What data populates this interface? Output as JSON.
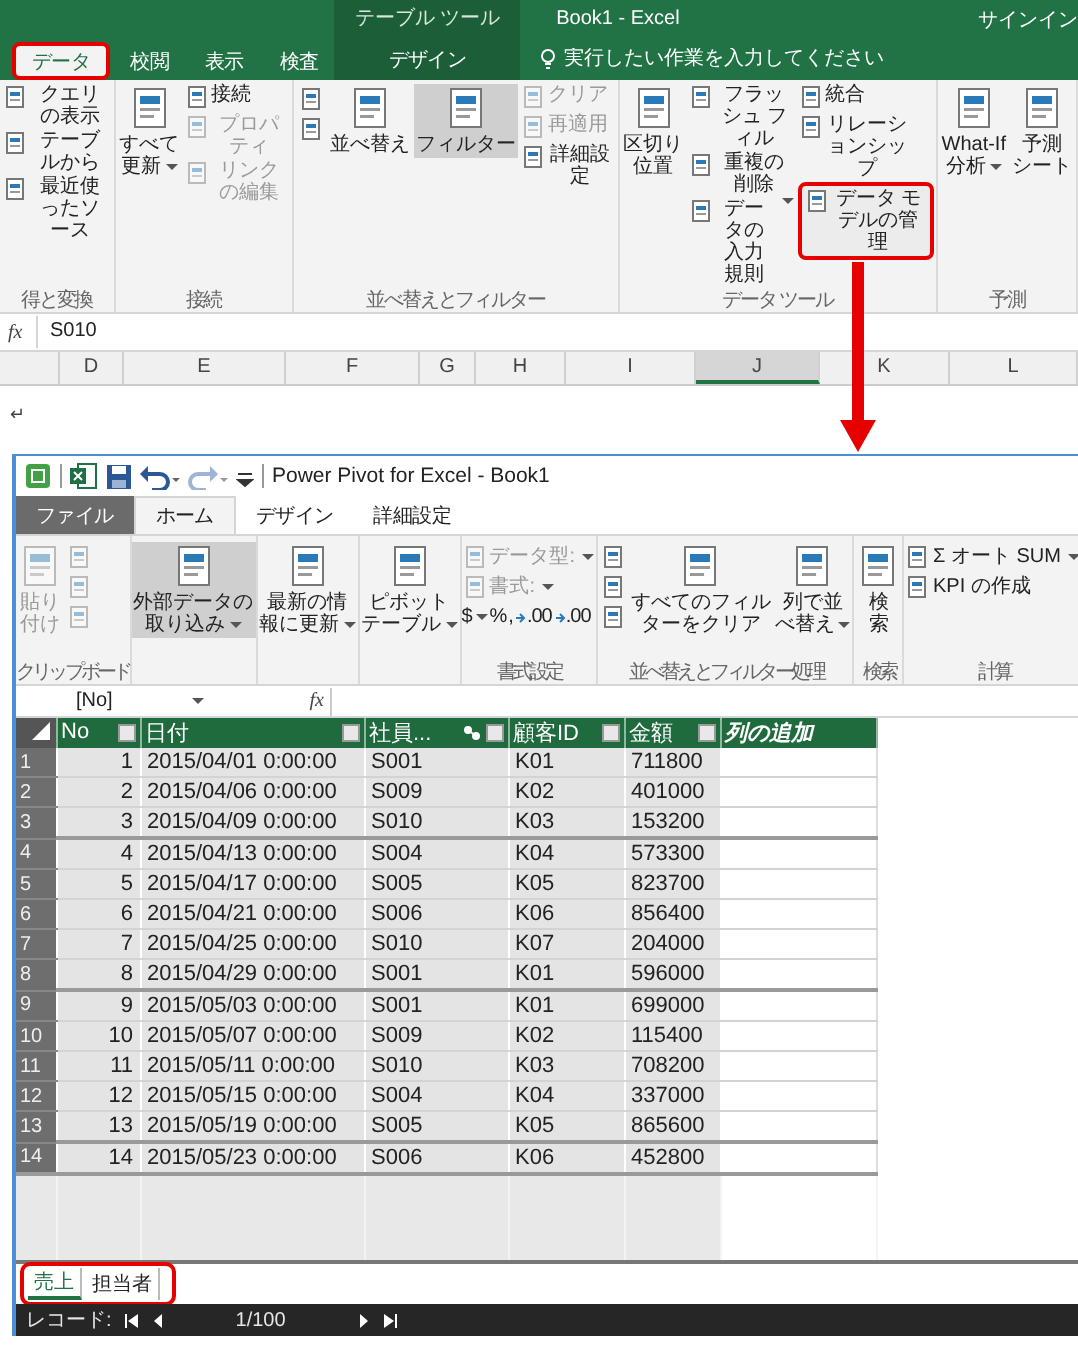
{
  "excel": {
    "context_label": "テーブル ツール",
    "title": "Book1 - Excel",
    "account": "サインイン",
    "tabs": [
      {
        "label": "データ",
        "kind": "normal",
        "selected": true,
        "highlighted": true
      },
      {
        "label": "校閲",
        "kind": "normal",
        "selected": false,
        "highlighted": false
      },
      {
        "label": "表示",
        "kind": "normal",
        "selected": false,
        "highlighted": false
      },
      {
        "label": "検査",
        "kind": "normal",
        "selected": false,
        "highlighted": false
      },
      {
        "label": "デザイン",
        "kind": "context",
        "selected": false,
        "highlighted": false
      }
    ],
    "tell_me": {
      "placeholder": "実行したい作業を入力してください"
    },
    "ribbon_groups": [
      {
        "label": "得と変換",
        "columns": [
          [
            {
              "kind": "small",
              "label": "クエリの表示",
              "disabled": false,
              "selected": false,
              "highlighted": false
            },
            {
              "kind": "small",
              "label": "テーブルから",
              "disabled": false,
              "selected": false,
              "highlighted": false
            },
            {
              "kind": "small",
              "label": "最近使ったソース",
              "disabled": false,
              "selected": false,
              "highlighted": false
            }
          ]
        ]
      },
      {
        "label": "接続",
        "columns": [
          [
            {
              "kind": "large",
              "lines": [
                "すべて",
                "更新"
              ],
              "dropdown": true,
              "disabled": false,
              "selected": false,
              "highlighted": false
            }
          ],
          [
            {
              "kind": "small",
              "label": "接続",
              "disabled": false,
              "selected": false,
              "highlighted": false
            },
            {
              "kind": "small",
              "label": "プロパティ",
              "disabled": true,
              "selected": false,
              "highlighted": false
            },
            {
              "kind": "small",
              "label": "リンクの編集",
              "disabled": true,
              "selected": false,
              "highlighted": false
            }
          ]
        ]
      },
      {
        "label": "並べ替えとフィルター",
        "columns": [
          [
            {
              "kind": "icon",
              "disabled": false,
              "selected": false,
              "highlighted": false
            },
            {
              "kind": "icon",
              "disabled": false,
              "selected": false,
              "highlighted": false
            }
          ],
          [
            {
              "kind": "large",
              "lines": [
                "並べ替え"
              ],
              "disabled": false,
              "selected": false,
              "highlighted": false
            }
          ],
          [
            {
              "kind": "large",
              "lines": [
                "フィルター"
              ],
              "disabled": false,
              "selected": true,
              "highlighted": false
            }
          ],
          [
            {
              "kind": "small",
              "label": "クリア",
              "disabled": true,
              "selected": false,
              "highlighted": false
            },
            {
              "kind": "small",
              "label": "再適用",
              "disabled": true,
              "selected": false,
              "highlighted": false
            },
            {
              "kind": "small",
              "label": "詳細設定",
              "disabled": false,
              "selected": false,
              "highlighted": false
            }
          ]
        ]
      },
      {
        "label": "データ ツール",
        "columns": [
          [
            {
              "kind": "large",
              "lines": [
                "区切り",
                "位置"
              ],
              "disabled": false,
              "selected": false,
              "highlighted": false
            }
          ],
          [
            {
              "kind": "small",
              "label": "フラッシュ フィル",
              "disabled": false,
              "selected": false,
              "highlighted": false
            },
            {
              "kind": "small",
              "label": "重複の削除",
              "disabled": false,
              "selected": false,
              "highlighted": false
            },
            {
              "kind": "small",
              "label": "データの入力規則",
              "dropdown": true,
              "disabled": false,
              "selected": false,
              "highlighted": false
            }
          ],
          [
            {
              "kind": "small",
              "label": "統合",
              "disabled": false,
              "selected": false,
              "highlighted": false
            },
            {
              "kind": "small",
              "label": "リレーションシップ",
              "disabled": false,
              "selected": false,
              "highlighted": false
            },
            {
              "kind": "small",
              "label": "データ モデルの管理",
              "disabled": false,
              "selected": false,
              "highlighted": true
            }
          ]
        ]
      },
      {
        "label": "予測",
        "columns": [
          [
            {
              "kind": "large",
              "lines": [
                "What-If",
                "分析"
              ],
              "dropdown": true,
              "disabled": false,
              "selected": false,
              "highlighted": false
            }
          ],
          [
            {
              "kind": "large",
              "lines": [
                "予測",
                "シート"
              ],
              "disabled": false,
              "selected": false,
              "highlighted": false
            }
          ]
        ]
      }
    ],
    "formula_label": "fx",
    "formula": "S010",
    "columns": [
      {
        "label": "D",
        "selected": false
      },
      {
        "label": "E",
        "selected": false
      },
      {
        "label": "F",
        "selected": false
      },
      {
        "label": "G",
        "selected": false
      },
      {
        "label": "H",
        "selected": false
      },
      {
        "label": "I",
        "selected": false
      },
      {
        "label": "J",
        "selected": true
      },
      {
        "label": "K",
        "selected": false
      },
      {
        "label": "L",
        "selected": false
      }
    ]
  },
  "return_mark": "↵",
  "power_pivot": {
    "title": "Power Pivot for Excel - Book1",
    "tabs": [
      {
        "label": "ファイル",
        "kind": "file",
        "selected": false
      },
      {
        "label": "ホーム",
        "kind": "normal",
        "selected": true
      },
      {
        "label": "デザイン",
        "kind": "normal",
        "selected": false
      },
      {
        "label": "詳細設定",
        "kind": "normal",
        "selected": false
      }
    ],
    "ribbon_groups": [
      {
        "label": "クリップボード",
        "columns": [
          [
            {
              "kind": "large",
              "lines": [
                "貼り",
                "付け"
              ],
              "disabled": true,
              "selected": false
            }
          ],
          [
            {
              "kind": "icon",
              "disabled": true,
              "selected": false
            },
            {
              "kind": "icon",
              "disabled": true,
              "selected": false
            },
            {
              "kind": "icon",
              "disabled": true,
              "selected": false
            }
          ]
        ]
      },
      {
        "columns": [
          [
            {
              "kind": "large",
              "lines": [
                "外部データの",
                "取り込み"
              ],
              "dropdown": true,
              "disabled": false,
              "selected": true
            }
          ]
        ]
      },
      {
        "columns": [
          [
            {
              "kind": "large",
              "lines": [
                "最新の情",
                "報に更新"
              ],
              "dropdown": true,
              "disabled": false,
              "selected": false
            }
          ]
        ]
      },
      {
        "columns": [
          [
            {
              "kind": "large",
              "lines": [
                "ピボット",
                "テーブル"
              ],
              "dropdown": true,
              "disabled": false,
              "selected": false
            }
          ]
        ]
      },
      {
        "label": "書式設定",
        "columns": [
          [
            {
              "kind": "small",
              "label": "データ型:",
              "dropdown": true,
              "disabled": true,
              "selected": false
            },
            {
              "kind": "small",
              "label": "書式:",
              "dropdown": true,
              "disabled": true,
              "selected": false
            },
            {
              "kind": "symbols",
              "symbols": [
                {
                  "text": "$",
                  "kind": "plain",
                  "dropdown": true
                },
                {
                  "text": "%",
                  "kind": "plain",
                  "dropdown": false
                },
                {
                  "text": ",",
                  "kind": "plain",
                  "dropdown": false
                },
                {
                  "text": ".00",
                  "kind": "decimal",
                  "dropdown": false
                },
                {
                  "text": ".00",
                  "kind": "decimal",
                  "dropdown": false
                }
              ]
            }
          ]
        ]
      },
      {
        "label": "並べ替えとフィルター処理",
        "columns": [
          [
            {
              "kind": "icon",
              "disabled": false,
              "selected": false
            },
            {
              "kind": "icon",
              "disabled": false,
              "selected": false
            },
            {
              "kind": "icon",
              "disabled": false,
              "selected": false
            }
          ],
          [
            {
              "kind": "large",
              "lines": [
                "すべてのフィル",
                "ターをクリア"
              ],
              "disabled": false,
              "selected": false
            }
          ],
          [
            {
              "kind": "large",
              "lines": [
                "列で並",
                "べ替え"
              ],
              "dropdown": true,
              "disabled": false,
              "selected": false
            }
          ]
        ]
      },
      {
        "label": "検索",
        "columns": [
          [
            {
              "kind": "large",
              "lines": [
                "検",
                "索"
              ],
              "disabled": false,
              "selected": false
            }
          ]
        ]
      },
      {
        "label": "計算",
        "columns": [
          [
            {
              "kind": "small",
              "label": "Σ オート SUM",
              "dropdown": true,
              "disabled": false,
              "selected": false
            },
            {
              "kind": "small",
              "label": "KPI の作成",
              "disabled": false,
              "selected": false
            }
          ]
        ]
      }
    ],
    "name_box": "[No]",
    "formula_label": "fx",
    "columns": [
      {
        "label": "No",
        "kind": "key",
        "filter": true,
        "related": false
      },
      {
        "label": "日付",
        "kind": "text",
        "filter": true,
        "related": false
      },
      {
        "label": "社員...",
        "kind": "text",
        "filter": true,
        "related": true
      },
      {
        "label": "顧客ID",
        "kind": "text",
        "filter": true,
        "related": false
      },
      {
        "label": "金額",
        "kind": "text",
        "filter": true,
        "related": false
      },
      {
        "label": "列の追加",
        "kind": "add",
        "filter": false,
        "related": false
      }
    ],
    "rows": [
      {
        "number": "1",
        "cells": [
          "1",
          "2015/04/01 0:00:00",
          "S001",
          "K01",
          "711800"
        ]
      },
      {
        "number": "2",
        "cells": [
          "2",
          "2015/04/06 0:00:00",
          "S009",
          "K02",
          "401000"
        ]
      },
      {
        "number": "3",
        "cells": [
          "3",
          "2015/04/09 0:00:00",
          "S010",
          "K03",
          "153200"
        ]
      },
      {
        "number": "4",
        "cells": [
          "4",
          "2015/04/13 0:00:00",
          "S004",
          "K04",
          "573300"
        ]
      },
      {
        "number": "5",
        "cells": [
          "5",
          "2015/04/17 0:00:00",
          "S005",
          "K05",
          "823700"
        ]
      },
      {
        "number": "6",
        "cells": [
          "6",
          "2015/04/21 0:00:00",
          "S006",
          "K06",
          "856400"
        ]
      },
      {
        "number": "7",
        "cells": [
          "7",
          "2015/04/25 0:00:00",
          "S010",
          "K07",
          "204000"
        ]
      },
      {
        "number": "8",
        "cells": [
          "8",
          "2015/04/29 0:00:00",
          "S001",
          "K01",
          "596000"
        ]
      },
      {
        "number": "9",
        "cells": [
          "9",
          "2015/05/03 0:00:00",
          "S001",
          "K01",
          "699000"
        ]
      },
      {
        "number": "10",
        "cells": [
          "10",
          "2015/05/07 0:00:00",
          "S009",
          "K02",
          "115400"
        ]
      },
      {
        "number": "11",
        "cells": [
          "11",
          "2015/05/11 0:00:00",
          "S010",
          "K03",
          "708200"
        ]
      },
      {
        "number": "12",
        "cells": [
          "12",
          "2015/05/15 0:00:00",
          "S004",
          "K04",
          "337000"
        ]
      },
      {
        "number": "13",
        "cells": [
          "13",
          "2015/05/19 0:00:00",
          "S005",
          "K05",
          "865600"
        ]
      },
      {
        "number": "14",
        "cells": [
          "14",
          "2015/05/23 0:00:00",
          "S006",
          "K06",
          "452800"
        ]
      }
    ],
    "sheet_tabs": {
      "highlighted": true,
      "tabs": [
        {
          "label": "売上",
          "selected": true
        },
        {
          "label": "担当者",
          "selected": false
        }
      ]
    },
    "status": {
      "label": "レコード:",
      "position": "1/100"
    }
  }
}
